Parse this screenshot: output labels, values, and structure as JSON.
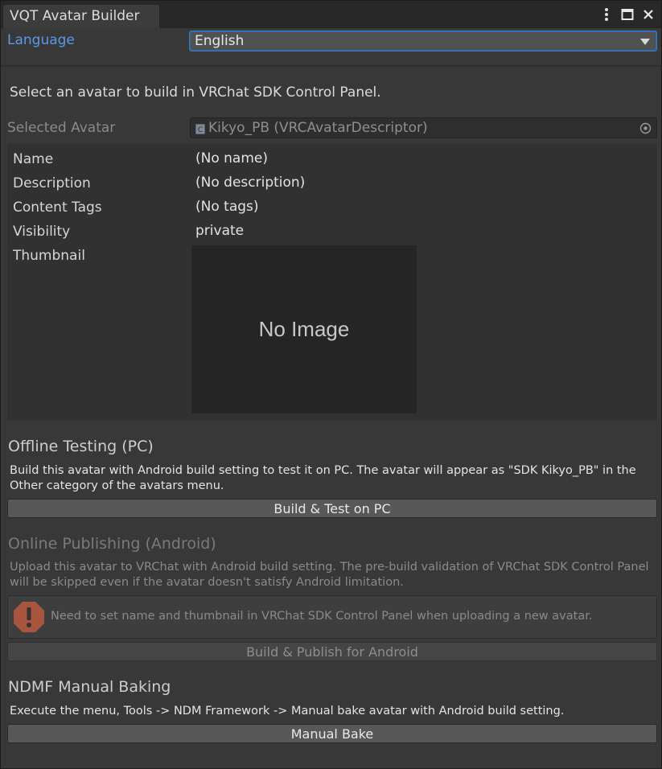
{
  "window": {
    "tab_title": "VQT Avatar Builder",
    "tools": [
      "more-options-icon",
      "maximize-icon",
      "close-icon"
    ]
  },
  "language": {
    "label": "Language",
    "selected": "English"
  },
  "intro": "Select an avatar to build in VRChat SDK Control Panel.",
  "selected_avatar": {
    "label": "Selected Avatar",
    "value": "Kikyo_PB (VRCAvatarDescriptor)"
  },
  "details": {
    "rows": [
      {
        "label": "Name",
        "value": "(No name)"
      },
      {
        "label": "Description",
        "value": "(No description)"
      },
      {
        "label": "Content Tags",
        "value": "(No tags)"
      },
      {
        "label": "Visibility",
        "value": "private"
      }
    ],
    "thumbnail_label": "Thumbnail",
    "thumbnail_placeholder": "No Image"
  },
  "offline": {
    "title": "Offline Testing (PC)",
    "description": "Build this avatar with Android build setting to test it on PC. The avatar will appear as \"SDK Kikyo_PB\" in the Other category of the avatars menu.",
    "button": "Build & Test on PC"
  },
  "online": {
    "title": "Online Publishing (Android)",
    "description": "Upload this avatar to VRChat with Android build setting. The pre-build validation of VRChat SDK Control Panel will be skipped even if the avatar doesn't satisfy Android limitation.",
    "warning": "Need to set name and thumbnail in VRChat SDK Control Panel when uploading a new avatar.",
    "button": "Build & Publish for Android"
  },
  "ndmf": {
    "title": "NDMF Manual Baking",
    "description": "Execute the menu, Tools -> NDM Framework -> Manual bake avatar with Android build setting.",
    "button": "Manual Bake"
  },
  "colors": {
    "background": "#383838",
    "accent_label": "#5b9ae8",
    "select_border": "#3a79bb",
    "warning_icon": "#e0623f"
  }
}
